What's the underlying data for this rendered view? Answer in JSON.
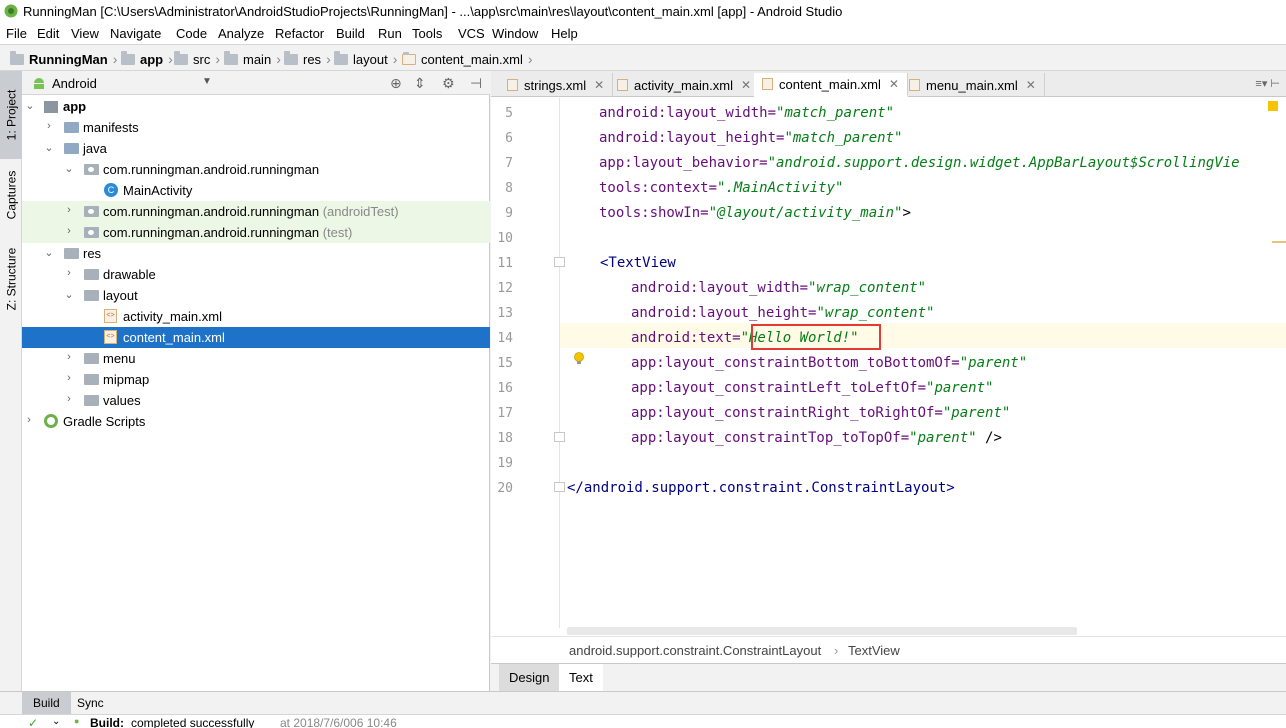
{
  "window": {
    "title": "RunningMan [C:\\Users\\Administrator\\AndroidStudioProjects\\RunningMan] - ...\\app\\src\\main\\res\\layout\\content_main.xml [app] - Android Studio"
  },
  "menu": [
    "File",
    "Edit",
    "View",
    "Navigate",
    "Code",
    "Analyze",
    "Refactor",
    "Build",
    "Run",
    "Tools",
    "VCS",
    "Window",
    "Help"
  ],
  "nav": {
    "crumbs": [
      "RunningMan",
      "app",
      "src",
      "main",
      "res",
      "layout",
      "content_main.xml"
    ]
  },
  "left_strip": {
    "project_tab": "1: Project",
    "captures_tab": "Captures",
    "structure_tab": "Z: Structure"
  },
  "project": {
    "view_selector": "Android",
    "tree": [
      {
        "label": "app",
        "suffix": ""
      },
      {
        "label": "manifests",
        "suffix": ""
      },
      {
        "label": "java",
        "suffix": ""
      },
      {
        "label": "com.runningman.android.runningman",
        "suffix": ""
      },
      {
        "label": "MainActivity",
        "suffix": ""
      },
      {
        "label": "com.runningman.android.runningman",
        "suffix": "(androidTest)"
      },
      {
        "label": "com.runningman.android.runningman",
        "suffix": "(test)"
      },
      {
        "label": "res",
        "suffix": ""
      },
      {
        "label": "drawable",
        "suffix": ""
      },
      {
        "label": "layout",
        "suffix": ""
      },
      {
        "label": "activity_main.xml",
        "suffix": ""
      },
      {
        "label": "content_main.xml",
        "suffix": ""
      },
      {
        "label": "menu",
        "suffix": ""
      },
      {
        "label": "mipmap",
        "suffix": ""
      },
      {
        "label": "values",
        "suffix": ""
      },
      {
        "label": "Gradle Scripts",
        "suffix": ""
      }
    ]
  },
  "editor": {
    "tabs": [
      "strings.xml",
      "activity_main.xml",
      "content_main.xml",
      "menu_main.xml"
    ],
    "active_tab": "content_main.xml",
    "line_numbers": [
      "5",
      "6",
      "7",
      "8",
      "9",
      "10",
      "11",
      "12",
      "13",
      "14",
      "15",
      "16",
      "17",
      "18",
      "19",
      "20"
    ],
    "code": {
      "l5": {
        "attr": "android:layout_width=",
        "val": "\"match_parent\""
      },
      "l6": {
        "attr": "android:layout_height=",
        "val": "\"match_parent\""
      },
      "l7": {
        "attr": "app:layout_behavior=",
        "val": "\"android.support.design.widget.AppBarLayout$ScrollingVie"
      },
      "l8": {
        "attr": "tools:context=",
        "val": "\".MainActivity\""
      },
      "l9": {
        "attr": "tools:showIn=",
        "val": "\"@layout/activity_main\"",
        "end": ">"
      },
      "l11": {
        "tag": "<TextView"
      },
      "l12": {
        "attr": "android:layout_width=",
        "val": "\"wrap_content\""
      },
      "l13": {
        "attr": "android:layout_height=",
        "val": "\"wrap_content\""
      },
      "l14": {
        "attr": "android:text=",
        "val": "\"Hello World!\""
      },
      "l15": {
        "attr": "app:layout_constraintBottom_toBottomOf=",
        "val": "\"parent\""
      },
      "l16": {
        "attr": "app:layout_constraintLeft_toLeftOf=",
        "val": "\"parent\""
      },
      "l17": {
        "attr": "app:layout_constraintRight_toRightOf=",
        "val": "\"parent\""
      },
      "l18": {
        "attr": "app:layout_constraintTop_toTopOf=",
        "val": "\"parent\"",
        "end": " />"
      },
      "l20": {
        "tag": "</android.support.constraint.ConstraintLayout>"
      }
    },
    "breadcrumbs": [
      "android.support.constraint.ConstraintLayout",
      "TextView"
    ],
    "design_tabs": [
      "Design",
      "Text"
    ],
    "active_design_tab": "Text"
  },
  "bottom": {
    "tabs": [
      "Build",
      "Sync"
    ],
    "status_bold": "Build:",
    "status_text": "completed successfully",
    "status_time": "at 2018/7/6/006 10:46"
  },
  "colors": {
    "selection": "#1e73c8",
    "highlight_box": "#e53935",
    "attr": "#660e7a",
    "string": "#067d17",
    "tag": "#000080",
    "green_row": "#edf7e5"
  }
}
